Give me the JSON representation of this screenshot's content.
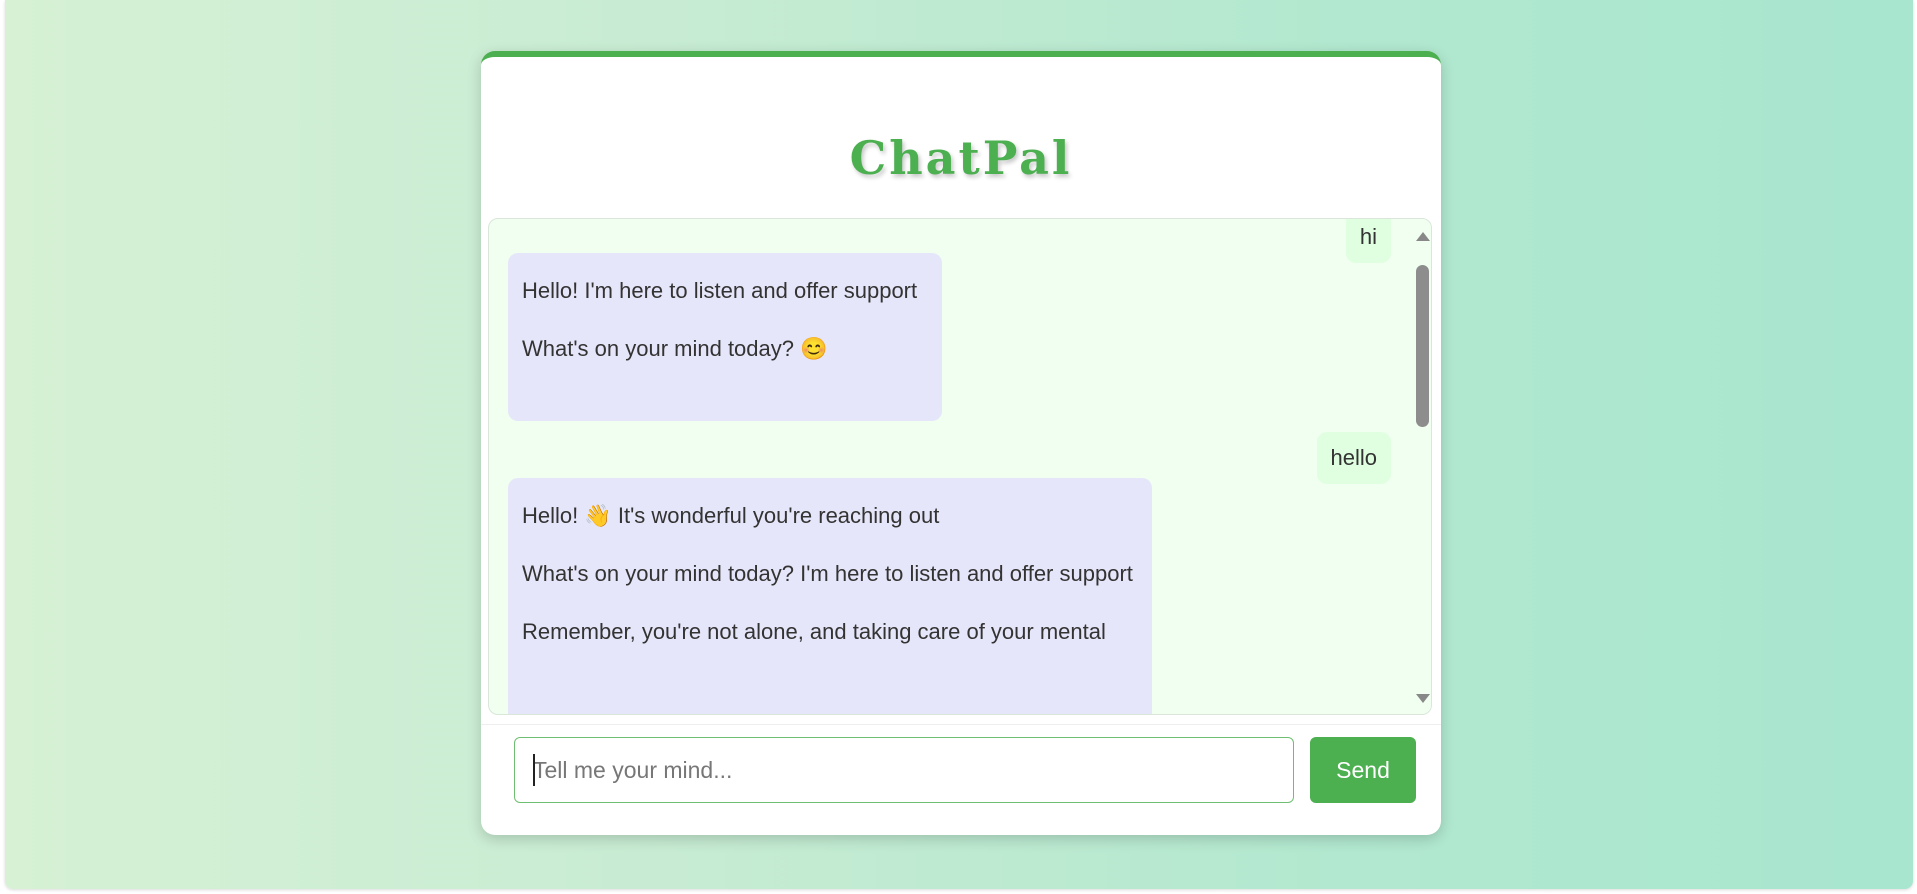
{
  "app": {
    "title": "ChatPal"
  },
  "colors": {
    "accent": "#4caf50",
    "user_bubble": "#e0ffe0",
    "bot_bubble": "#e6e6fa",
    "chat_background": "#f0fff0"
  },
  "chat": {
    "messages": [
      {
        "role": "user",
        "text": "hi"
      },
      {
        "role": "bot",
        "paragraphs": [
          "Hello! I'm here to listen and offer support",
          "What's on your mind today? 😊"
        ]
      },
      {
        "role": "user",
        "text": "hello"
      },
      {
        "role": "bot",
        "paragraphs": [
          "Hello! 👋  It's wonderful you're reaching out",
          "What's on your mind today? I'm here to listen and offer support",
          "Remember, you're not alone, and taking care of your mental"
        ]
      }
    ]
  },
  "composer": {
    "placeholder": "Tell me your mind...",
    "value": "",
    "send_label": "Send"
  }
}
